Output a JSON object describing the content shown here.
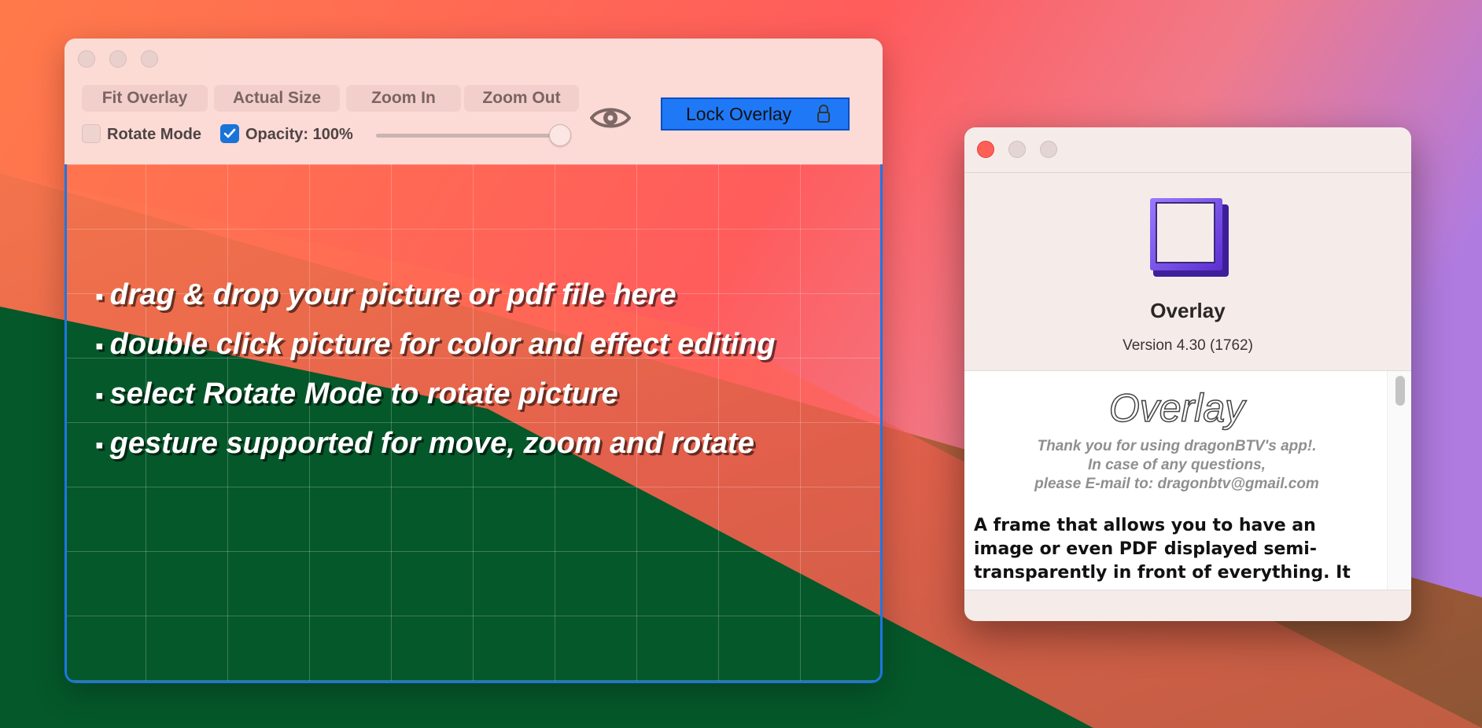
{
  "main_window": {
    "toolbar": {
      "fit_overlay": "Fit Overlay",
      "actual_size": "Actual Size",
      "zoom_in": "Zoom In",
      "zoom_out": "Zoom Out",
      "rotate_mode": {
        "label": "Rotate Mode",
        "checked": false
      },
      "opacity": {
        "label": "Opacity: 100%",
        "checked": true,
        "value_percent": 100
      },
      "eye_icon": "eye-icon",
      "lock_overlay": "Lock Overlay",
      "lock_icon": "lock-icon",
      "accent_color": "#1f79f7"
    },
    "hints": [
      "drag & drop your picture or pdf file here",
      "double click picture for color and effect editing",
      "select Rotate Mode to rotate picture",
      "gesture supported for move, zoom and rotate"
    ],
    "hint_bullet": "▪"
  },
  "about_window": {
    "app_name": "Overlay",
    "version": "Version 4.30 (1762)",
    "credits": {
      "title": "Overlay",
      "thanks_lines": [
        "Thank you for using dragonBTV's app!.",
        "In case of any questions,",
        "please E-mail to: dragonbtv@gmail.com"
      ],
      "description": "A frame that allows you to have an image or even PDF displayed semi-transparently in front of everything. It"
    }
  }
}
